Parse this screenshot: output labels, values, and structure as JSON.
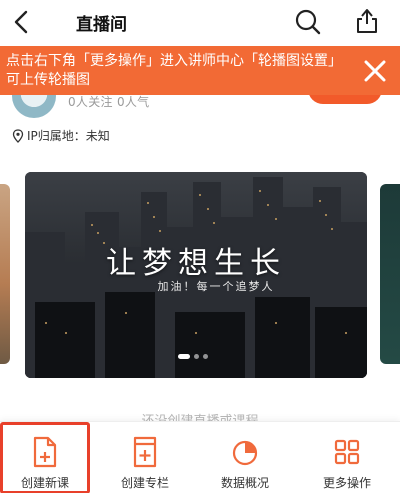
{
  "header": {
    "title": "直播间"
  },
  "profile": {
    "stats": "0人关注 0人气",
    "ip_location": "IP归属地：未知"
  },
  "tip": {
    "text": "点击右下角「更多操作」进入讲师中心「轮播图设置」可上传轮播图"
  },
  "carousel": {
    "slogan": "让梦想生长",
    "subslogan": "加油！每一个追梦人",
    "slide_count": 3,
    "active_index": 0
  },
  "hint": "还没创建直播或课程",
  "toolbar": {
    "items": [
      {
        "label": "创建新课",
        "icon": "new-course-icon"
      },
      {
        "label": "创建专栏",
        "icon": "new-column-icon"
      },
      {
        "label": "数据概况",
        "icon": "data-overview-icon"
      },
      {
        "label": "更多操作",
        "icon": "more-actions-icon"
      }
    ],
    "selected_index": 0
  },
  "colors": {
    "accent": "#f26a35",
    "brand_orange": "#f25a2a",
    "icon_orange": "#f06a3c",
    "highlight_border": "#e8402a"
  }
}
